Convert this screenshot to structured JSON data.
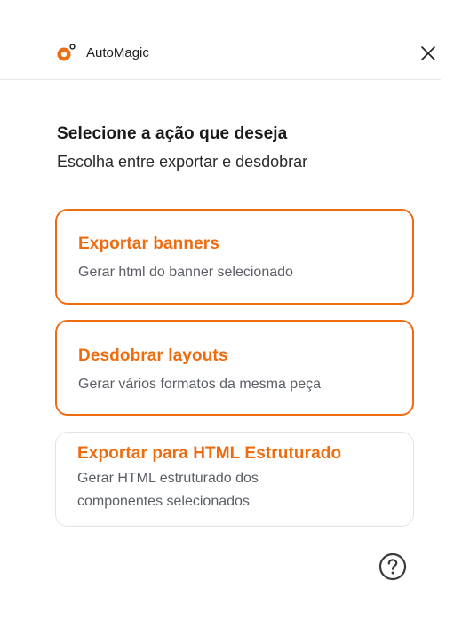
{
  "header": {
    "app_name": "AutoMagic",
    "logo_icon": "automagic-logo-icon",
    "close_icon": "close-icon"
  },
  "intro": {
    "title": "Selecione a ação que deseja",
    "subtitle": "Escolha entre exportar e desdobrar"
  },
  "actions": [
    {
      "title": "Exportar banners",
      "description": "Gerar html do banner selecionado",
      "state": "highlighted"
    },
    {
      "title": "Desdobrar layouts",
      "description": "Gerar vários formatos da mesma peça",
      "state": "highlighted"
    },
    {
      "title": "Exportar para HTML Estruturado",
      "description": "Gerar HTML estruturado dos componentes selecionados",
      "state": "default"
    }
  ],
  "footer": {
    "help_icon": "help-circle-icon"
  },
  "colors": {
    "accent": "#ee6c10",
    "text_primary": "#1a1a1a",
    "text_secondary": "#5a5f66",
    "border_default": "#e3e3e3",
    "divider": "#e6e6e6"
  }
}
